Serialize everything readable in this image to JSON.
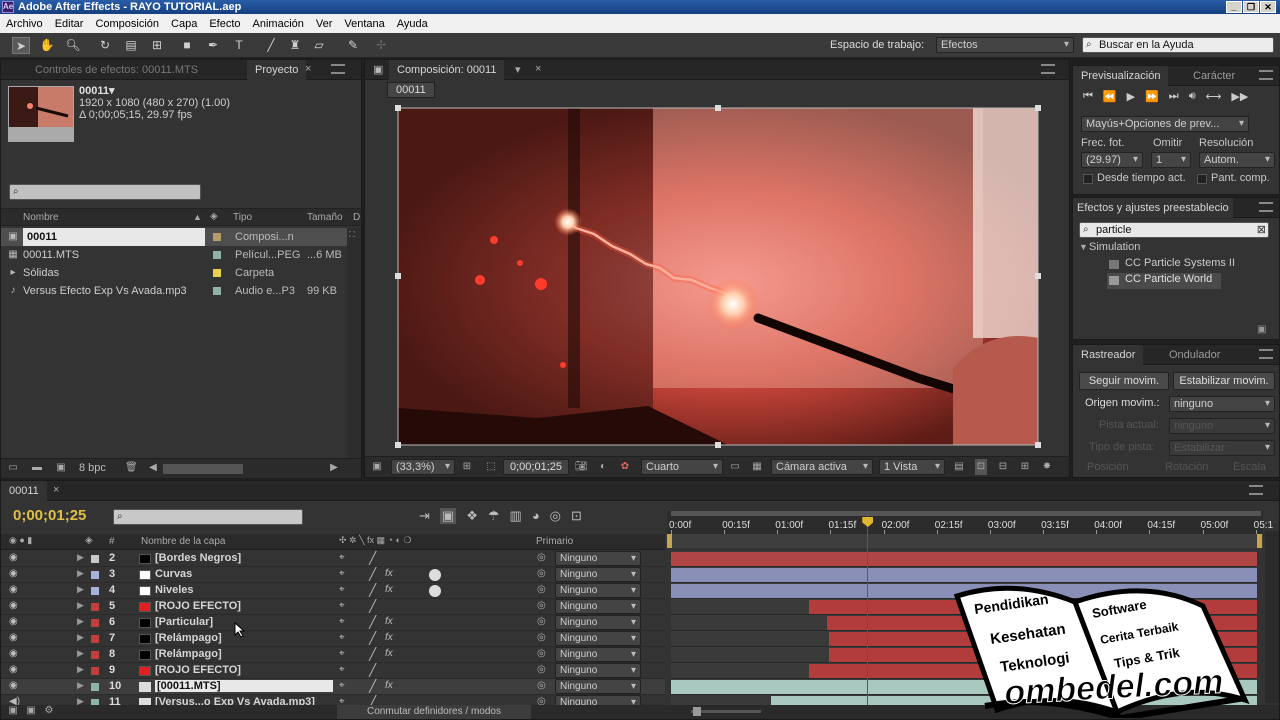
{
  "window": {
    "title": "Adobe After Effects - RAYO TUTORIAL.aep",
    "app_icon": "Ae",
    "controls": [
      "_",
      "❐",
      "✕"
    ]
  },
  "menu": [
    "Archivo",
    "Editar",
    "Composición",
    "Capa",
    "Efecto",
    "Animación",
    "Ver",
    "Ventana",
    "Ayuda"
  ],
  "toolbar": {
    "workspace_label": "Espacio de trabajo:",
    "workspace_value": "Efectos",
    "help_search": "Buscar en la Ayuda"
  },
  "project_panel": {
    "tabs": [
      "Controles de efectos: 00011.MTS",
      "Proyecto"
    ],
    "selected_name": "00011▾",
    "selected_info": [
      "1920 x 1080  (480 x 270) (1.00)",
      "Δ 0;00;05;15, 29.97 fps"
    ],
    "columns": [
      "Nombre",
      "Tipo",
      "Tamaño",
      "D"
    ],
    "items": [
      {
        "name": "00011",
        "type": "Composi...n",
        "size": "",
        "color": "#b59a6a",
        "icon": "composition-icon"
      },
      {
        "name": "00011.MTS",
        "type": "Películ...PEG",
        "size": "...6 MB",
        "color": "#8fb3a8",
        "icon": "footage-icon"
      },
      {
        "name": "Sólidas",
        "type": "Carpeta",
        "size": "",
        "color": "#e6d24a",
        "icon": "folder-icon"
      },
      {
        "name": "Versus Efecto Exp Vs Avada.mp3",
        "type": "Audio e...P3",
        "size": "99 KB",
        "color": "#8fb3a8",
        "icon": "audio-icon"
      }
    ],
    "bpc": "8 bpc"
  },
  "comp_panel": {
    "tab": "Composición: 00011",
    "comp_chip": "00011",
    "zoom": "(33,3%)",
    "timecode": "0;00;01;25",
    "resolution": "Cuarto",
    "camera": "Cámara activa",
    "view": "1 Vista"
  },
  "preview_panel": {
    "tabs": [
      "Previsualización",
      "Carácter"
    ],
    "ram_option": "Mayús+Opciones de prev...",
    "frame_rate_label": "Frec. fot.",
    "skip_label": "Omitir",
    "resolution_label": "Resolución",
    "frame_rate": "(29.97)",
    "skip": "1",
    "resolution": "Autom.",
    "from_current": "Desde tiempo act.",
    "full_screen": "Pant. comp."
  },
  "effects_panel": {
    "tab": "Efectos y ajustes preestablecio",
    "search": "particle",
    "category": "Simulation",
    "items": [
      "CC Particle Systems II",
      "CC Particle World"
    ]
  },
  "tracker_panel": {
    "tabs": [
      "Rastreador",
      "Ondulador"
    ],
    "track_button": "Seguir movim.",
    "stabilize_button": "Estabilizar movim.",
    "source_label": "Origen movim.:",
    "source_value": "ninguno",
    "current_track_label": "Pista actual:",
    "current_track_value": "ninguno",
    "track_type_label": "Tipo de pista:",
    "track_type_value": "Estabilizar",
    "position": "Posición",
    "rotation": "Rotación",
    "scale": "Escala"
  },
  "timeline": {
    "tab": "00011",
    "timecode": "0;00;01;25",
    "layer_col": "Nombre de la capa",
    "num_col": "#",
    "parent_col": "Primario",
    "toggle_label": "Conmutar definidores / modos",
    "ruler": [
      "0:00f",
      "00:15f",
      "01:00f",
      "01:15f",
      "02:00f",
      "02:15f",
      "03:00f",
      "03:15f",
      "04:00f",
      "04:15f",
      "05:00f",
      "05:1"
    ],
    "playhead_fraction": 0.335,
    "layers": [
      {
        "num": "2",
        "name": "[Bordes Negros]",
        "color": "#c8c8c8",
        "swatch": "#000000",
        "parent": "Ninguno",
        "bar_color": "#b04545",
        "bar_start": 0.0,
        "bar_end": 1.0
      },
      {
        "num": "3",
        "name": "Curvas",
        "color": "#aab0d8",
        "swatch": "#ffffff",
        "parent": "Ninguno",
        "bar_color": "#8a8fb8",
        "bar_start": 0.0,
        "bar_end": 1.0
      },
      {
        "num": "4",
        "name": "Niveles",
        "color": "#aab0d8",
        "swatch": "#ffffff",
        "parent": "Ninguno",
        "bar_color": "#8a8fb8",
        "bar_start": 0.0,
        "bar_end": 1.0
      },
      {
        "num": "5",
        "name": "[ROJO EFECTO]",
        "color": "#c04040",
        "swatch": "#e02020",
        "parent": "Ninguno",
        "bar_color": "#b23c3c",
        "bar_start": 0.235,
        "bar_end": 1.0
      },
      {
        "num": "6",
        "name": "[Particular]",
        "color": "#c04040",
        "swatch": "#000000",
        "parent": "Ninguno",
        "bar_color": "#b23c3c",
        "bar_start": 0.266,
        "bar_end": 1.0
      },
      {
        "num": "7",
        "name": "[Relámpago]",
        "color": "#c04040",
        "swatch": "#000000",
        "parent": "Ninguno",
        "bar_color": "#b23c3c",
        "bar_start": 0.27,
        "bar_end": 1.0
      },
      {
        "num": "8",
        "name": "[Relámpago]",
        "color": "#c04040",
        "swatch": "#000000",
        "parent": "Ninguno",
        "bar_color": "#b23c3c",
        "bar_start": 0.27,
        "bar_end": 1.0
      },
      {
        "num": "9",
        "name": "[ROJO EFECTO]",
        "color": "#c04040",
        "swatch": "#e02020",
        "parent": "Ninguno",
        "bar_color": "#b23c3c",
        "bar_start": 0.235,
        "bar_end": 1.0
      },
      {
        "num": "10",
        "name": "[00011.MTS]",
        "color": "#8fb3a8",
        "swatch": "footage",
        "parent": "Ninguno",
        "bar_color": "#a9c9c0",
        "bar_start": 0.0,
        "bar_end": 1.0,
        "selected": true
      },
      {
        "num": "11",
        "name": "[Versus...o Exp Vs Avada.mp3]",
        "color": "#8fb3a8",
        "swatch": "audio",
        "parent": "Ninguno",
        "bar_color": "#a9c9c0",
        "bar_start": 0.17,
        "bar_end": 1.0
      }
    ]
  },
  "watermark": {
    "words_left": [
      "Pendidikan",
      "Kesehatan",
      "Teknologi"
    ],
    "words_right": [
      "Software",
      "Cerita Terbaik",
      "Tips & Trik"
    ],
    "site": "ombedel.com"
  },
  "colors": {
    "accent": "#e0c046",
    "playhead": "#e02020",
    "panel": "#333333"
  }
}
